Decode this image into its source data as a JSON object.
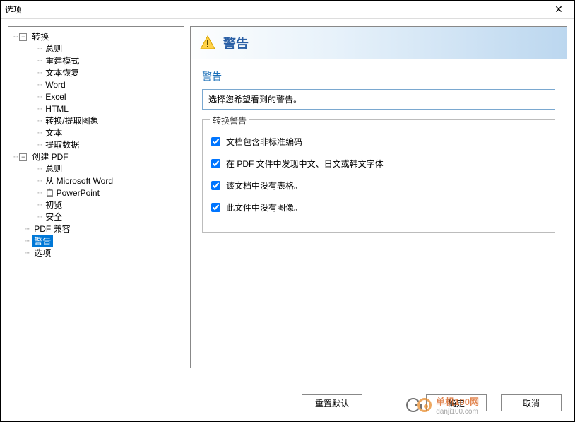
{
  "window": {
    "title": "选项",
    "close": "✕"
  },
  "tree": {
    "n0": {
      "label": "转换",
      "exp": "−"
    },
    "n0_0": {
      "label": "总则"
    },
    "n0_1": {
      "label": "重建模式"
    },
    "n0_2": {
      "label": "文本恢复"
    },
    "n0_3": {
      "label": "Word"
    },
    "n0_4": {
      "label": "Excel"
    },
    "n0_5": {
      "label": "HTML"
    },
    "n0_6": {
      "label": "转换/提取图象"
    },
    "n0_7": {
      "label": "文本"
    },
    "n0_8": {
      "label": "提取数据"
    },
    "n1": {
      "label": "创建 PDF",
      "exp": "−"
    },
    "n1_0": {
      "label": "总则"
    },
    "n1_1": {
      "label": "从 Microsoft Word"
    },
    "n1_2": {
      "label": "自 PowerPoint"
    },
    "n1_3": {
      "label": "初览"
    },
    "n1_4": {
      "label": "安全"
    },
    "n2": {
      "label": "PDF 兼容"
    },
    "n3": {
      "label": "警告"
    },
    "n4": {
      "label": "选项"
    }
  },
  "panel": {
    "header": "警告",
    "subhead": "警告",
    "desc": "选择您希望看到的警告。",
    "legend": "转换警告",
    "checks": {
      "c0": "文档包含非标准编码",
      "c1": "在 PDF 文件中发现中文、日文或韩文字体",
      "c2": "该文档中没有表格。",
      "c3": "此文件中没有图像。"
    }
  },
  "buttons": {
    "reset": "重置默认",
    "ok": "确定",
    "cancel": "取消"
  },
  "watermark": {
    "brand": "单机100网",
    "url": "danji100.com"
  }
}
